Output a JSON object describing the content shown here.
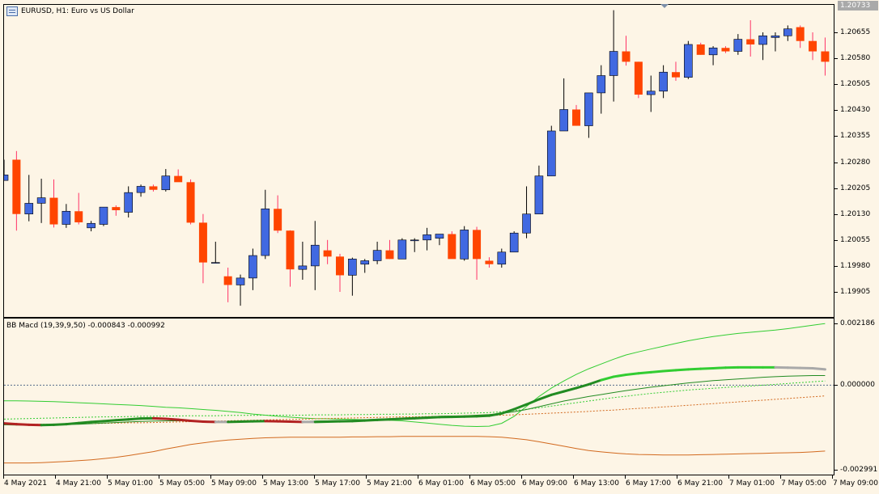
{
  "chart": {
    "symbol_title": "EURUSD, H1:  Euro vs US Dollar",
    "indicator_title": "BB Macd (19,39,9,50) -0.000843 -0.000992",
    "current_price": "1.20733",
    "price_axis_labels": [
      "1.20655",
      "1.20580",
      "1.20505",
      "1.20430",
      "1.20355",
      "1.20280",
      "1.20205",
      "1.20130",
      "1.20055",
      "1.19980",
      "1.19905"
    ],
    "indicator_axis_labels": [
      "0.002186",
      "0.000000",
      "-0.002991"
    ],
    "time_axis_labels": [
      "4 May 2021",
      "4 May 21:00",
      "5 May 01:00",
      "5 May 05:00",
      "5 May 09:00",
      "5 May 13:00",
      "5 May 17:00",
      "5 May 21:00",
      "6 May 01:00",
      "6 May 05:00",
      "6 May 09:00",
      "6 May 13:00",
      "6 May 17:00",
      "6 May 21:00",
      "7 May 01:00",
      "7 May 05:00",
      "7 May 09:00"
    ],
    "colors": {
      "background": "#FDF5E6",
      "bull_candle": "#4169E1",
      "bear_candle": "#FF4500",
      "bull_wick": "#000000",
      "bear_wick": "#FF3366",
      "macd_up": "#228B22",
      "macd_down": "#B22222",
      "upper_band": "#32CD32",
      "lower_band": "#D2691E",
      "zero_line": "#556B8B"
    }
  },
  "candles": [
    [
      1.20227,
      1.20287,
      1.20227,
      1.20243
    ],
    [
      1.20287,
      1.20312,
      1.20082,
      1.2013
    ],
    [
      1.2013,
      1.20243,
      1.20109,
      1.20161
    ],
    [
      1.20161,
      1.20232,
      1.20104,
      1.20177
    ],
    [
      1.20177,
      1.2023,
      1.20091,
      1.201
    ],
    [
      1.201,
      1.20159,
      1.2009,
      1.20138
    ],
    [
      1.20138,
      1.20191,
      1.201,
      1.20106
    ],
    [
      1.2009,
      1.2011,
      1.2008,
      1.20103
    ],
    [
      1.201,
      1.2015,
      1.20095,
      1.2015
    ],
    [
      1.2015,
      1.20155,
      1.20125,
      1.20141
    ],
    [
      1.20135,
      1.2021,
      1.2012,
      1.20192
    ],
    [
      1.20192,
      1.20215,
      1.2018,
      1.2021
    ],
    [
      1.2021,
      1.20215,
      1.20195,
      1.202
    ],
    [
      1.202,
      1.2026,
      1.20195,
      1.2024
    ],
    [
      1.2024,
      1.20259,
      1.20225,
      1.20222
    ],
    [
      1.20222,
      1.2023,
      1.201,
      1.20105
    ],
    [
      1.20105,
      1.2013,
      1.1993,
      1.1999
    ],
    [
      1.1999,
      1.2005,
      1.1999,
      1.1999
    ],
    [
      1.1995,
      1.19975,
      1.19875,
      1.19925
    ],
    [
      1.19925,
      1.19955,
      1.19865,
      1.19945
    ],
    [
      1.19945,
      1.2003,
      1.1991,
      1.2001
    ],
    [
      1.2001,
      1.202,
      1.2,
      1.20145
    ],
    [
      1.20145,
      1.20184,
      1.20075,
      1.20082
    ],
    [
      1.20082,
      1.20083,
      1.1992,
      1.1997
    ],
    [
      1.1997,
      1.2005,
      1.1994,
      1.1998
    ],
    [
      1.1998,
      1.2011,
      1.1991,
      1.2004
    ],
    [
      1.20025,
      1.20055,
      1.19985,
      1.20007
    ],
    [
      1.20007,
      1.20015,
      1.19905,
      1.19953
    ],
    [
      1.19953,
      1.20004,
      1.19894,
      1.2
    ],
    [
      1.19985,
      1.2,
      1.1996,
      1.19995
    ],
    [
      1.19995,
      1.2005,
      1.19985,
      1.20025
    ],
    [
      1.20025,
      1.20055,
      1.2,
      1.2
    ],
    [
      1.2,
      1.2006,
      1.2,
      1.20055
    ],
    [
      1.20055,
      1.2006,
      1.2002,
      1.20055
    ],
    [
      1.20055,
      1.2009,
      1.20025,
      1.2007
    ],
    [
      1.2006,
      1.20072,
      1.2004,
      1.20072
    ],
    [
      1.20072,
      1.2008,
      1.20045,
      1.2
    ],
    [
      1.2,
      1.20095,
      1.19995,
      1.20084
    ],
    [
      1.20084,
      1.20093,
      1.1994,
      1.2
    ],
    [
      1.19995,
      1.20005,
      1.19975,
      1.19985
    ],
    [
      1.19985,
      1.2003,
      1.19975,
      1.2002
    ],
    [
      1.2002,
      1.2008,
      1.2002,
      1.20075
    ],
    [
      1.20075,
      1.2021,
      1.2006,
      1.2013
    ],
    [
      1.2013,
      1.2027,
      1.2013,
      1.2024
    ],
    [
      1.2024,
      1.20385,
      1.2024,
      1.2037
    ],
    [
      1.2037,
      1.20522,
      1.2037,
      1.20432
    ],
    [
      1.20432,
      1.20445,
      1.20385,
      1.20385
    ],
    [
      1.20385,
      1.2048,
      1.2035,
      1.2048
    ],
    [
      1.2048,
      1.2056,
      1.2042,
      1.2053
    ],
    [
      1.2053,
      1.20719,
      1.20455,
      1.206
    ],
    [
      1.206,
      1.20645,
      1.20559,
      1.2057
    ],
    [
      1.2057,
      1.2057,
      1.20465,
      1.20475
    ],
    [
      1.20475,
      1.2053,
      1.20425,
      1.20485
    ],
    [
      1.20485,
      1.2056,
      1.20465,
      1.2054
    ],
    [
      1.2054,
      1.2057,
      1.20515,
      1.20525
    ],
    [
      1.20525,
      1.2063,
      1.2052,
      1.2062
    ],
    [
      1.2062,
      1.20625,
      1.2059,
      1.2059
    ],
    [
      1.2059,
      1.20615,
      1.2056,
      1.2061
    ],
    [
      1.2061,
      1.20615,
      1.20595,
      1.206
    ],
    [
      1.206,
      1.2065,
      1.2059,
      1.20635
    ],
    [
      1.20635,
      1.2069,
      1.20585,
      1.2062
    ],
    [
      1.2062,
      1.20655,
      1.20575,
      1.20645
    ],
    [
      1.2064,
      1.20655,
      1.206,
      1.20645
    ],
    [
      1.20645,
      1.20675,
      1.2063,
      1.20665
    ],
    [
      1.2067,
      1.20675,
      1.2061,
      1.2063
    ],
    [
      1.2063,
      1.20655,
      1.20575,
      1.206
    ],
    [
      1.206,
      1.2064,
      1.2053,
      1.2057
    ]
  ],
  "indicator": {
    "upper_band": [
      -0.00055,
      -0.00055,
      -0.00056,
      -0.00057,
      -0.00058,
      -0.0006,
      -0.00062,
      -0.00064,
      -0.00066,
      -0.00068,
      -0.0007,
      -0.00072,
      -0.00075,
      -0.00078,
      -0.0008,
      -0.00083,
      -0.00086,
      -0.00089,
      -0.00093,
      -0.00097,
      -0.00102,
      -0.00106,
      -0.0011,
      -0.00113,
      -0.00116,
      -0.00118,
      -0.00119,
      -0.0012,
      -0.00121,
      -0.00122,
      -0.00123,
      -0.00124,
      -0.00126,
      -0.0013,
      -0.00134,
      -0.00138,
      -0.00142,
      -0.00145,
      -0.00146,
      -0.00145,
      -0.00135,
      -0.0011,
      -0.00075,
      -0.0004,
      -0.0001,
      0.00015,
      0.00038,
      0.00058,
      0.00075,
      0.00092,
      0.00107,
      0.00118,
      0.00128,
      0.00138,
      0.00148,
      0.00157,
      0.00165,
      0.00172,
      0.00178,
      0.00183,
      0.00187,
      0.00191,
      0.00195,
      0.002,
      0.00206,
      0.00212,
      0.00218
    ],
    "lower_band": [
      -0.00275,
      -0.00275,
      -0.00275,
      -0.00274,
      -0.00272,
      -0.0027,
      -0.00267,
      -0.00264,
      -0.0026,
      -0.00255,
      -0.00249,
      -0.00242,
      -0.00235,
      -0.00226,
      -0.00218,
      -0.0021,
      -0.00204,
      -0.00198,
      -0.00194,
      -0.00191,
      -0.00188,
      -0.00186,
      -0.00185,
      -0.00184,
      -0.00184,
      -0.00184,
      -0.00184,
      -0.00184,
      -0.00183,
      -0.00183,
      -0.00182,
      -0.00182,
      -0.00181,
      -0.00181,
      -0.00181,
      -0.00181,
      -0.00181,
      -0.00181,
      -0.00181,
      -0.00182,
      -0.00184,
      -0.00188,
      -0.00193,
      -0.002,
      -0.00208,
      -0.00216,
      -0.00224,
      -0.00231,
      -0.00236,
      -0.0024,
      -0.00243,
      -0.00245,
      -0.00246,
      -0.00247,
      -0.00247,
      -0.00247,
      -0.00246,
      -0.00245,
      -0.00244,
      -0.00243,
      -0.00242,
      -0.00241,
      -0.0024,
      -0.00239,
      -0.00238,
      -0.00236,
      -0.00233
    ],
    "upper_mid": [
      -0.0012,
      -0.00119,
      -0.00118,
      -0.00117,
      -0.00116,
      -0.00115,
      -0.00114,
      -0.00113,
      -0.00112,
      -0.00112,
      -0.00111,
      -0.0011,
      -0.0011,
      -0.00109,
      -0.00109,
      -0.00108,
      -0.00108,
      -0.00108,
      -0.00107,
      -0.00107,
      -0.00107,
      -0.00106,
      -0.00106,
      -0.00106,
      -0.00106,
      -0.00105,
      -0.00105,
      -0.00105,
      -0.00104,
      -0.00104,
      -0.00103,
      -0.00103,
      -0.00102,
      -0.00102,
      -0.00101,
      -0.00101,
      -0.001,
      -0.00099,
      -0.00098,
      -0.00097,
      -0.00094,
      -0.0009,
      -0.00085,
      -0.0008,
      -0.00074,
      -0.00068,
      -0.00062,
      -0.00056,
      -0.0005,
      -0.00044,
      -0.00039,
      -0.00034,
      -0.00029,
      -0.00025,
      -0.00021,
      -0.00017,
      -0.00014,
      -0.00011,
      -8e-05,
      -5e-05,
      -3e-05,
      0.0,
      3e-05,
      6e-05,
      9e-05,
      0.00012,
      0.00015
    ],
    "lower_mid": [
      -0.0014,
      -0.00139,
      -0.00139,
      -0.00138,
      -0.00138,
      -0.00137,
      -0.00136,
      -0.00136,
      -0.00135,
      -0.00134,
      -0.00133,
      -0.00133,
      -0.00132,
      -0.00131,
      -0.0013,
      -0.00129,
      -0.00128,
      -0.00127,
      -0.00126,
      -0.00125,
      -0.00124,
      -0.00123,
      -0.00122,
      -0.00121,
      -0.0012,
      -0.00119,
      -0.00118,
      -0.00117,
      -0.00116,
      -0.00115,
      -0.00114,
      -0.00113,
      -0.00112,
      -0.00112,
      -0.00111,
      -0.0011,
      -0.00109,
      -0.00109,
      -0.00108,
      -0.00107,
      -0.00106,
      -0.00105,
      -0.00103,
      -0.00101,
      -0.00099,
      -0.00097,
      -0.00095,
      -0.00093,
      -0.0009,
      -0.00088,
      -0.00085,
      -0.00082,
      -0.0008,
      -0.00077,
      -0.00074,
      -0.00071,
      -0.00068,
      -0.00065,
      -0.00062,
      -0.00059,
      -0.00056,
      -0.00053,
      -0.0005,
      -0.00047,
      -0.00044,
      -0.00041,
      -0.00038
    ],
    "signal": [
      -0.0014,
      -0.00141,
      -0.00141,
      -0.00141,
      -0.0014,
      -0.00139,
      -0.00138,
      -0.00136,
      -0.00134,
      -0.00132,
      -0.0013,
      -0.00128,
      -0.00127,
      -0.00126,
      -0.00126,
      -0.00126,
      -0.00127,
      -0.00128,
      -0.00129,
      -0.00129,
      -0.00129,
      -0.00129,
      -0.00129,
      -0.00129,
      -0.00128,
      -0.00127,
      -0.00126,
      -0.00125,
      -0.00124,
      -0.00122,
      -0.0012,
      -0.00118,
      -0.00116,
      -0.00114,
      -0.00112,
      -0.0011,
      -0.00109,
      -0.00108,
      -0.00106,
      -0.00104,
      -0.001,
      -0.00094,
      -0.00086,
      -0.00076,
      -0.00066,
      -0.00056,
      -0.00048,
      -0.0004,
      -0.00033,
      -0.00026,
      -0.00019,
      -0.00013,
      -7e-05,
      -2e-05,
      3e-05,
      8e-05,
      0.00012,
      0.00016,
      0.00019,
      0.00022,
      0.00025,
      0.00028,
      0.0003,
      0.00032,
      0.00033,
      0.00034,
      0.00034
    ],
    "macd": [
      -0.00135,
      -0.00138,
      -0.0014,
      -0.00141,
      -0.0014,
      -0.00138,
      -0.00134,
      -0.0013,
      -0.00127,
      -0.00124,
      -0.00121,
      -0.00118,
      -0.00117,
      -0.00119,
      -0.00122,
      -0.00126,
      -0.00129,
      -0.0013,
      -0.0013,
      -0.00129,
      -0.00128,
      -0.00127,
      -0.00128,
      -0.00129,
      -0.0013,
      -0.0013,
      -0.00129,
      -0.00128,
      -0.00127,
      -0.00125,
      -0.00123,
      -0.00121,
      -0.00119,
      -0.00117,
      -0.00115,
      -0.00113,
      -0.00112,
      -0.00111,
      -0.0011,
      -0.00108,
      -0.001,
      -0.00085,
      -0.00068,
      -0.0005,
      -0.00034,
      -0.00022,
      -0.0001,
      3e-05,
      0.00018,
      0.0003,
      0.00037,
      0.00042,
      0.00046,
      0.0005,
      0.00053,
      0.00056,
      0.00058,
      0.0006,
      0.00062,
      0.00063,
      0.00063,
      0.00063,
      0.00063,
      0.00062,
      0.00061,
      0.0006,
      0.00056
    ]
  }
}
